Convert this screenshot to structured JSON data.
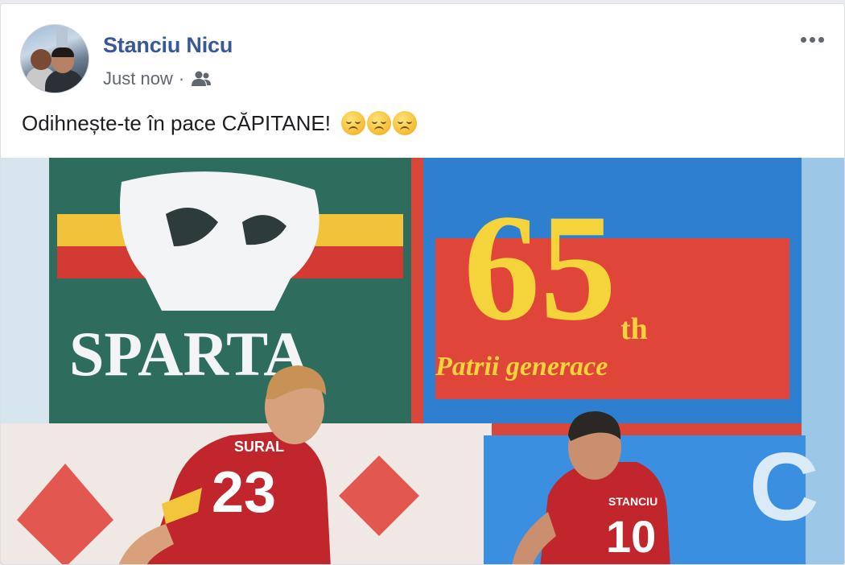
{
  "post": {
    "author": "Stanciu Nicu",
    "timestamp": "Just now",
    "separator": "·",
    "audience_icon": "friends-icon",
    "more_icon": "more-options-icon",
    "text": "Odihnește-te în pace CĂPITANE!",
    "emojis": [
      "disappointed-face-emoji",
      "disappointed-face-emoji",
      "disappointed-face-emoji"
    ]
  },
  "photo": {
    "banner_left_text": "SPARTA",
    "banner_right_number": "65",
    "banner_right_suffix": "th",
    "banner_right_text": "Patrii generace",
    "player_left": {
      "name": "SURAL",
      "number": "23"
    },
    "player_right": {
      "name": "STANCIU",
      "number": "10"
    }
  },
  "colors": {
    "author": "#385898",
    "meta": "#606770",
    "body_text": "#1c1e21",
    "jersey_red": "#c0262c"
  }
}
